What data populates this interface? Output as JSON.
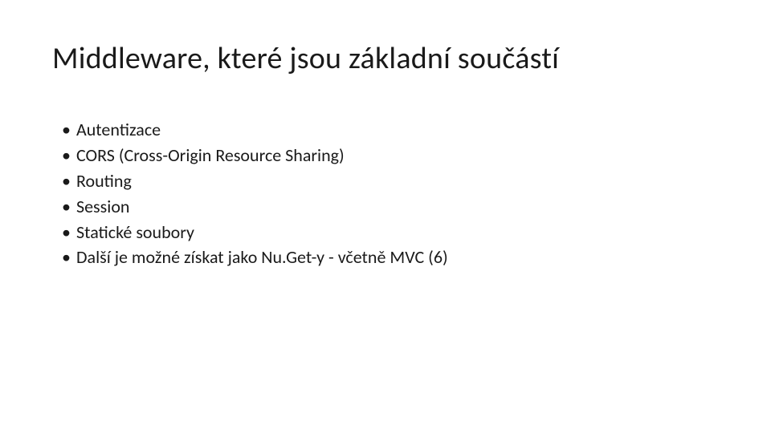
{
  "slide": {
    "title": "Middleware, které jsou základní součástí",
    "bullets": [
      "Autentizace",
      "CORS (Cross-Origin Resource Sharing)",
      "Routing",
      "Session",
      "Statické soubory",
      "Další je možné získat jako Nu.Get-y - včetně MVC (6)"
    ]
  }
}
